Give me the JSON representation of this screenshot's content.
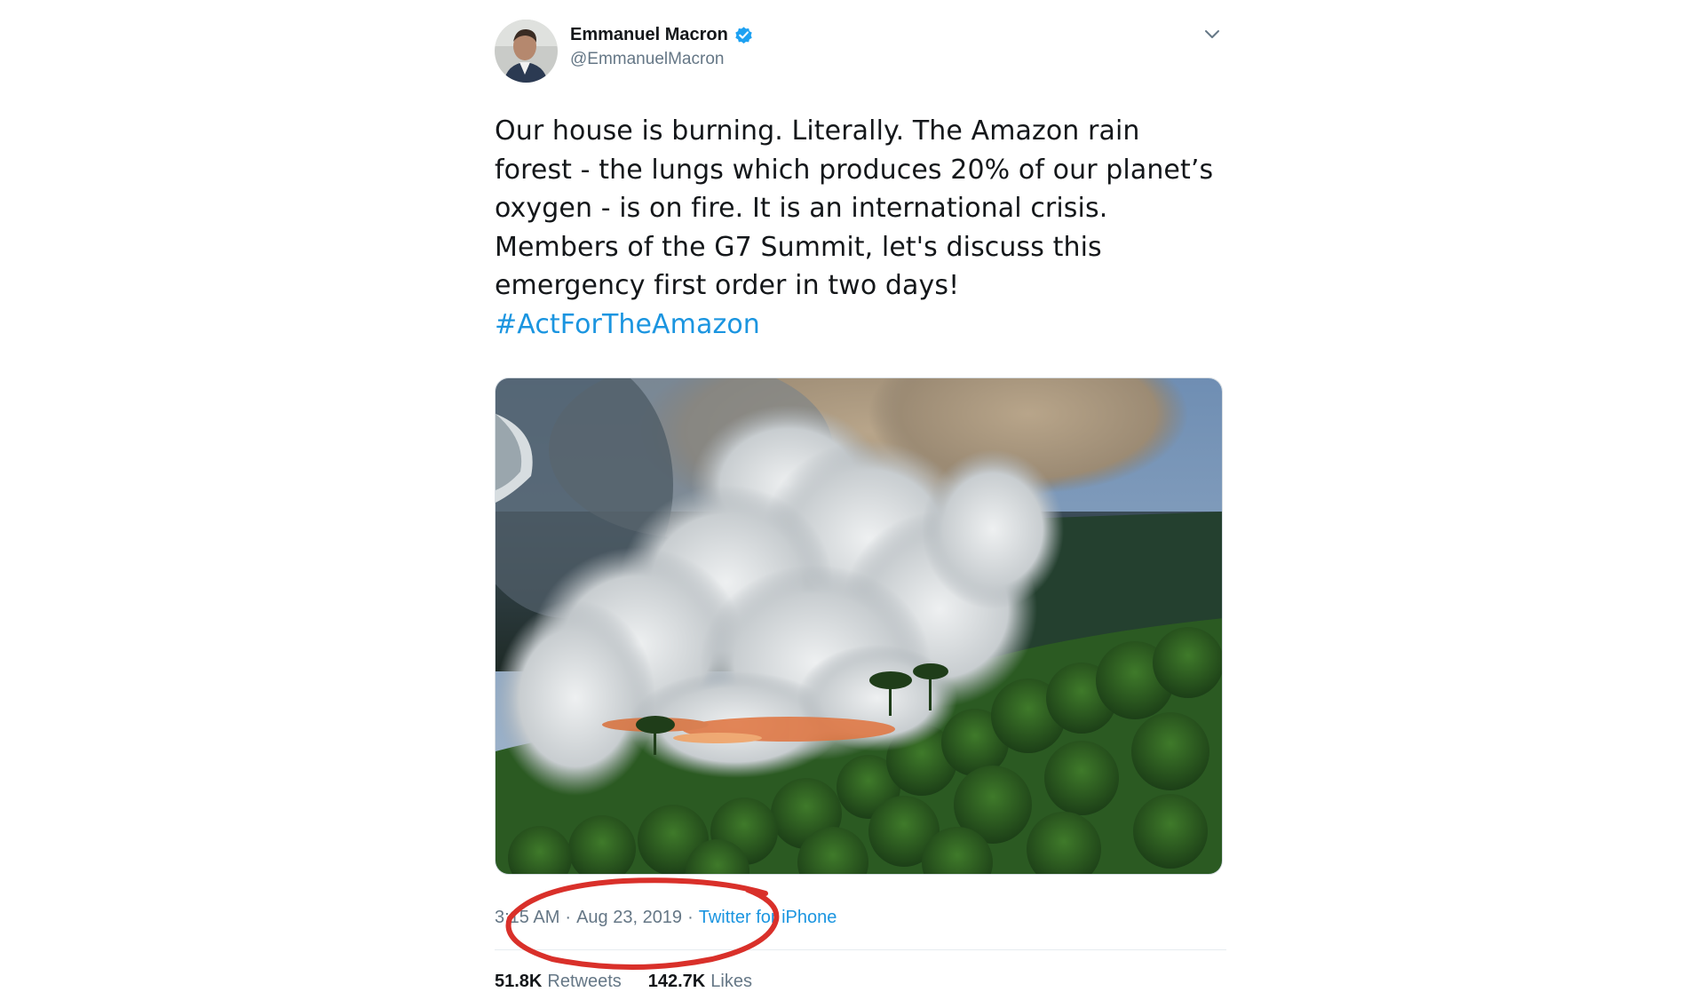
{
  "author": {
    "name": "Emmanuel Macron",
    "handle": "@EmmanuelMacron",
    "verified": true
  },
  "tweet": {
    "text": "Our house is burning. Literally. The Amazon rain forest - the lungs which produces 20% of our planet’s oxygen - is on fire. It is an international crisis. Members of the G7 Summit, let's discuss this emergency first order in two days!",
    "hashtag": "#ActForTheAmazon"
  },
  "meta": {
    "time": "3:15 AM",
    "date": "Aug 23, 2019",
    "separator": "·",
    "source": "Twitter for iPhone"
  },
  "stats": {
    "retweets_count": "51.8K",
    "retweets_label": "Retweets",
    "likes_count": "142.7K",
    "likes_label": "Likes"
  },
  "icons": {
    "verified": "verified-badge-icon",
    "menu": "chevron-down-icon"
  },
  "colors": {
    "link": "#1b95e0",
    "text": "#14171a",
    "muted": "#657786",
    "annotation": "#d9302a"
  }
}
